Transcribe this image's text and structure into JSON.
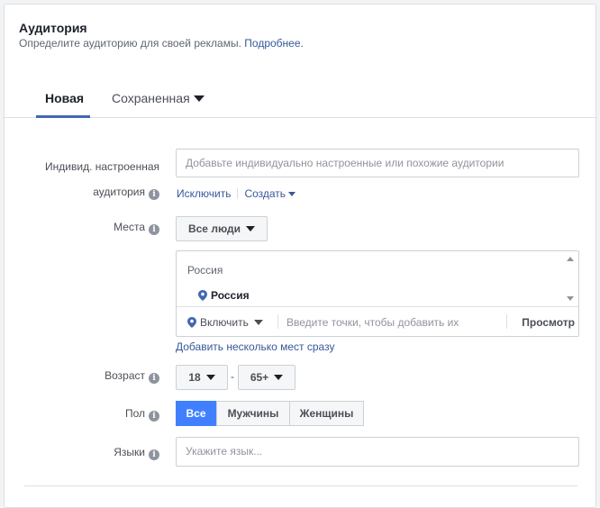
{
  "header": {
    "title": "Аудитория",
    "subtitle": "Определите аудиторию для своей рекламы.",
    "more_link": "Подробнее."
  },
  "tabs": {
    "new_label": "Новая",
    "saved_label": "Сохраненная"
  },
  "custom_audience": {
    "label_line1": "Индивид. настроенная",
    "label_line2": "аудитория",
    "placeholder": "Добавьте индивидуально настроенные или похожие аудитории",
    "exclude_link": "Исключить",
    "create_link": "Создать"
  },
  "locations": {
    "label": "Места",
    "people_select": "Все люди",
    "country_group": "Россия",
    "selected_item": "Россия",
    "include_select": "Включить",
    "input_placeholder": "Введите точки, чтобы добавить их",
    "browse": "Просмотр",
    "bulk_link": "Добавить несколько мест сразу"
  },
  "age": {
    "label": "Возраст",
    "min": "18",
    "max": "65+",
    "separator": "-"
  },
  "gender": {
    "label": "Пол",
    "options": [
      "Все",
      "Мужчины",
      "Женщины"
    ],
    "selected": "Все"
  },
  "languages": {
    "label": "Языки",
    "placeholder": "Укажите язык..."
  },
  "colors": {
    "accent": "#4267b2",
    "link": "#365899",
    "active_segment": "#4080ff"
  }
}
